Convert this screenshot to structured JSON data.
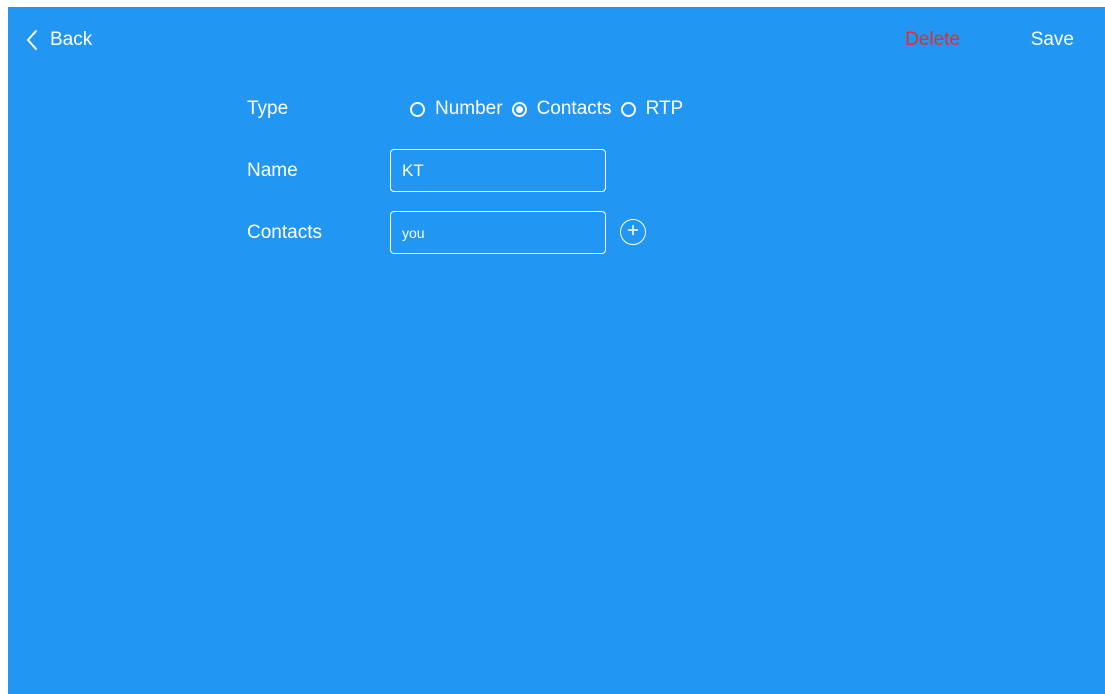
{
  "header": {
    "back_label": "Back",
    "delete_label": "Delete",
    "save_label": "Save"
  },
  "form": {
    "type_label": "Type",
    "type_options": [
      {
        "label": "Number",
        "selected": false
      },
      {
        "label": "Contacts",
        "selected": true
      },
      {
        "label": "RTP",
        "selected": false
      }
    ],
    "name_label": "Name",
    "name_value": "KT",
    "contacts_label": "Contacts",
    "contacts_value": "you"
  },
  "colors": {
    "background": "#2196f3",
    "text": "#ffffff",
    "delete": "#ea2a2f"
  },
  "icons": {
    "back": "chevron-left-icon",
    "add": "plus-circle-icon"
  }
}
